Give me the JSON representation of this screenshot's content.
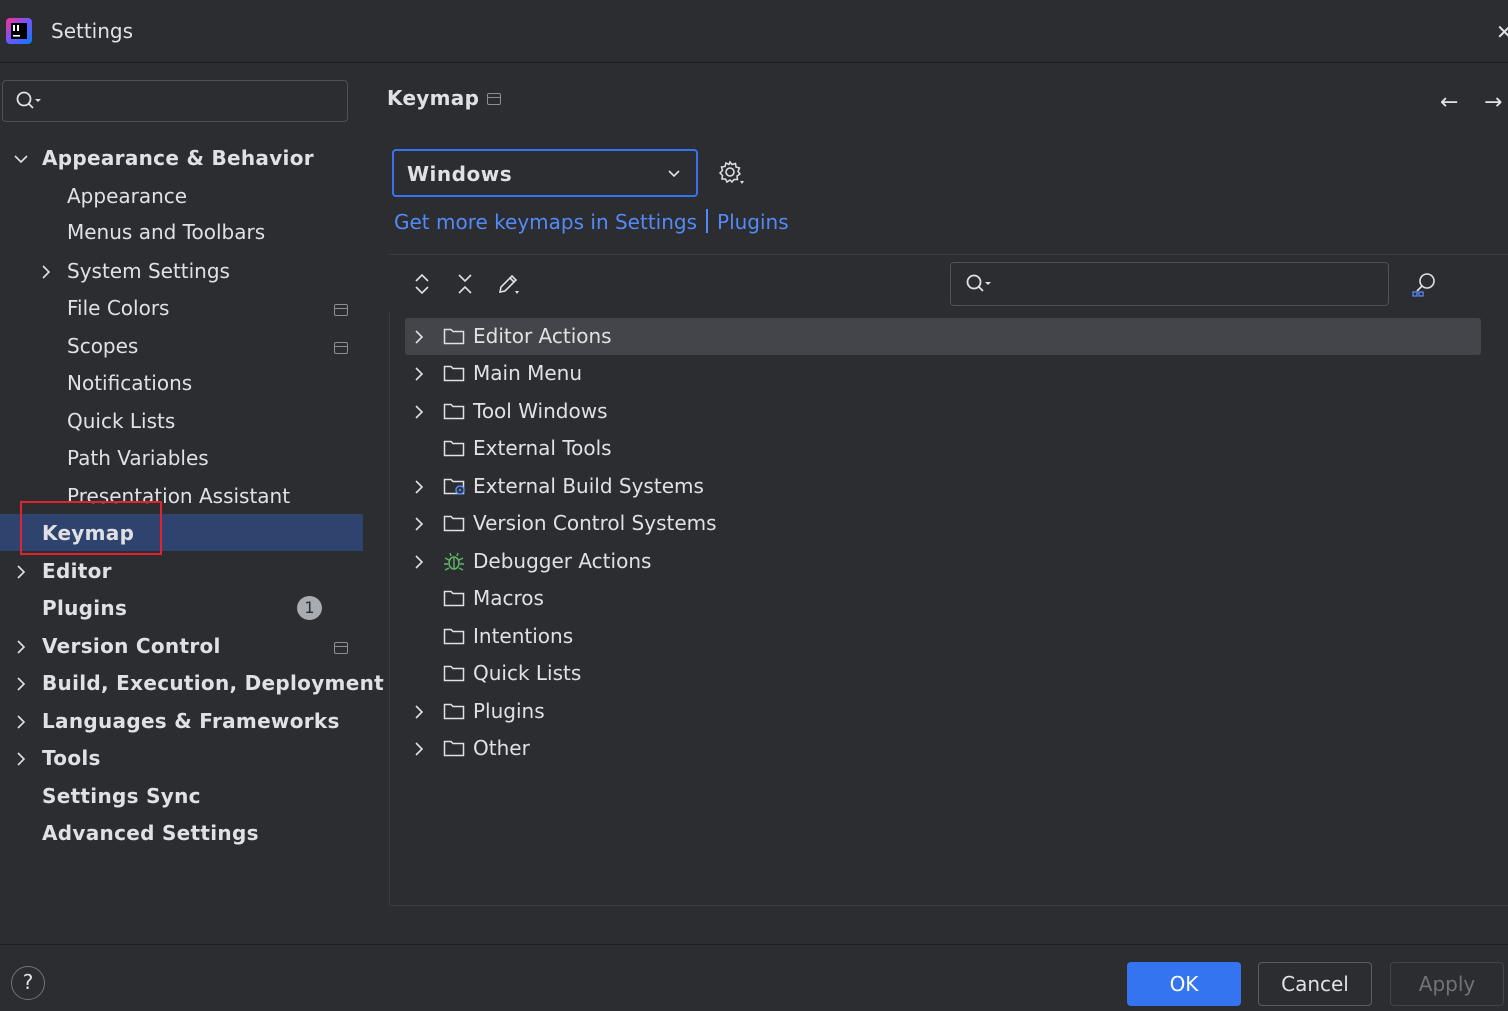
{
  "window": {
    "title": "Settings"
  },
  "sidebar": {
    "search_placeholder": "",
    "items": [
      {
        "label": "Appearance & Behavior",
        "level": 0,
        "expanded": true
      },
      {
        "label": "Appearance",
        "level": 1
      },
      {
        "label": "Menus and Toolbars",
        "level": 1
      },
      {
        "label": "System Settings",
        "level": 1,
        "expandable": true
      },
      {
        "label": "File Colors",
        "level": 1,
        "project_icon": true
      },
      {
        "label": "Scopes",
        "level": 1,
        "project_icon": true
      },
      {
        "label": "Notifications",
        "level": 1
      },
      {
        "label": "Quick Lists",
        "level": 1
      },
      {
        "label": "Path Variables",
        "level": 1
      },
      {
        "label": "Presentation Assistant",
        "level": 1
      },
      {
        "label": "Keymap",
        "level": 0,
        "selected": true
      },
      {
        "label": "Editor",
        "level": 0,
        "expandable": true
      },
      {
        "label": "Plugins",
        "level": 0,
        "badge": "1"
      },
      {
        "label": "Version Control",
        "level": 0,
        "expandable": true,
        "project_icon": true
      },
      {
        "label": "Build, Execution, Deployment",
        "level": 0,
        "expandable": true
      },
      {
        "label": "Languages & Frameworks",
        "level": 0,
        "expandable": true
      },
      {
        "label": "Tools",
        "level": 0,
        "expandable": true
      },
      {
        "label": "Settings Sync",
        "level": 0
      },
      {
        "label": "Advanced Settings",
        "level": 0
      }
    ]
  },
  "panel": {
    "title": "Keymap",
    "keymap_select": {
      "value": "Windows"
    },
    "links": {
      "text1": "Get more keymaps in Settings",
      "text2": "Plugins"
    },
    "action_search_placeholder": "",
    "tree": [
      {
        "label": "Editor Actions",
        "expandable": true,
        "icon": "folder-icon",
        "selected": true
      },
      {
        "label": "Main Menu",
        "expandable": true,
        "icon": "folder-icon"
      },
      {
        "label": "Tool Windows",
        "expandable": true,
        "icon": "folder-icon"
      },
      {
        "label": "External Tools",
        "expandable": false,
        "icon": "folder-icon"
      },
      {
        "label": "External Build Systems",
        "expandable": true,
        "icon": "folder-gear-icon"
      },
      {
        "label": "Version Control Systems",
        "expandable": true,
        "icon": "folder-icon"
      },
      {
        "label": "Debugger Actions",
        "expandable": true,
        "icon": "bug-icon"
      },
      {
        "label": "Macros",
        "expandable": false,
        "icon": "folder-icon"
      },
      {
        "label": "Intentions",
        "expandable": false,
        "icon": "folder-icon"
      },
      {
        "label": "Quick Lists",
        "expandable": false,
        "icon": "folder-icon"
      },
      {
        "label": "Plugins",
        "expandable": true,
        "icon": "folder-icon"
      },
      {
        "label": "Other",
        "expandable": true,
        "icon": "folder-icon"
      }
    ]
  },
  "footer": {
    "help": "?",
    "ok": "OK",
    "cancel": "Cancel",
    "apply": "Apply"
  },
  "colors": {
    "accent": "#3574f0",
    "link": "#548af7",
    "selection": "#2e436e",
    "background": "#2b2d30",
    "highlight_box": "#e0232e"
  }
}
